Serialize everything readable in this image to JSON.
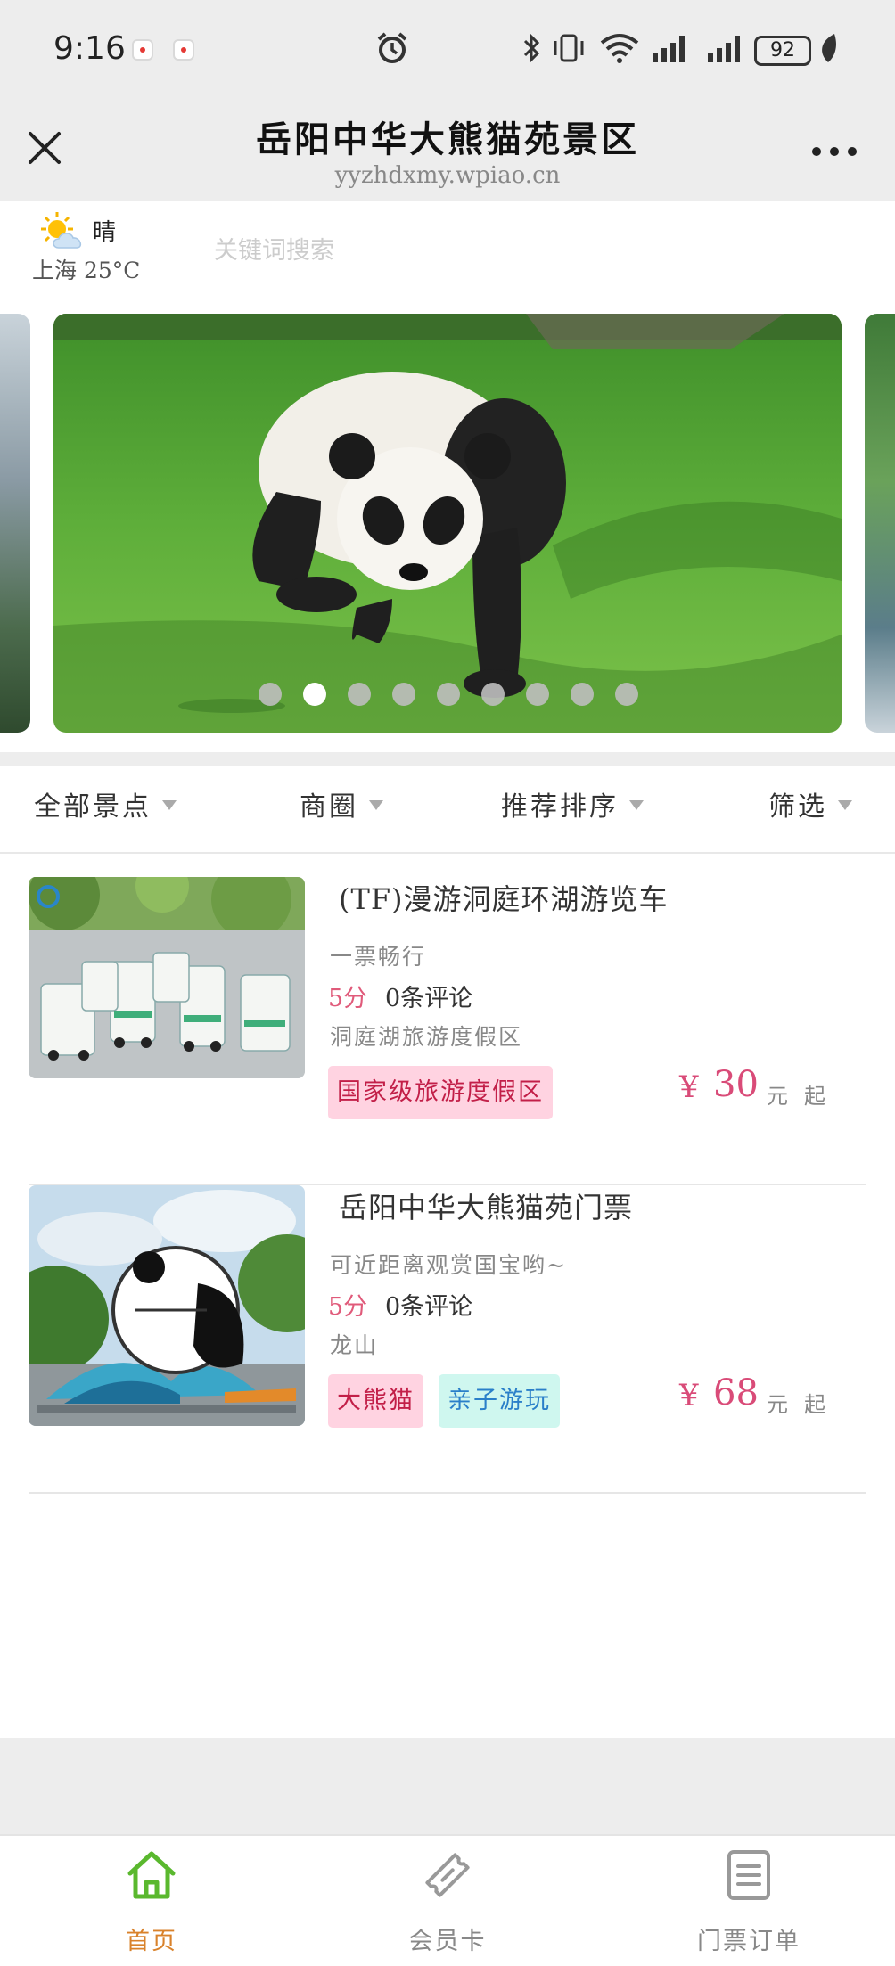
{
  "status_bar": {
    "time": "9:16",
    "battery": "92"
  },
  "header": {
    "title": "岳阳中华大熊猫苑景区",
    "url": "yyzhdxmy.wpiao.cn",
    "close_icon": "close-icon",
    "more_icon": "more-dots-icon"
  },
  "weather": {
    "condition": "晴",
    "city_temp": "上海 25°C",
    "icon": "sun-cloud-icon"
  },
  "search": {
    "placeholder": "关键词搜索",
    "value": ""
  },
  "banner": {
    "slide_count": 9,
    "active_index": 1
  },
  "filters": [
    {
      "label": "全部景点"
    },
    {
      "label": "商圈"
    },
    {
      "label": "推荐排序"
    },
    {
      "label": "筛选"
    }
  ],
  "items": [
    {
      "title": "(TF)漫游洞庭环湖游览车",
      "desc": "一票畅行",
      "score": "5分",
      "reviews": "0条评论",
      "location": "洞庭湖旅游度假区",
      "tags": [
        {
          "label": "国家级旅游度假区",
          "color": "#ffd3e1"
        }
      ],
      "currency": "¥",
      "price": "30",
      "unit": "元",
      "from": "起"
    },
    {
      "title": "岳阳中华大熊猫苑门票",
      "desc": "可近距离观赏国宝哟~",
      "score": "5分",
      "reviews": "0条评论",
      "location": "龙山",
      "tags": [
        {
          "label": "大熊猫",
          "color": "#ffd3e1"
        },
        {
          "label": "亲子游玩",
          "color": "#cff7ef"
        }
      ],
      "currency": "¥",
      "price": "68",
      "unit": "元",
      "from": "起"
    }
  ],
  "bottom_nav": [
    {
      "label": "首页",
      "icon": "home-icon",
      "active": true,
      "color": "#d9822b"
    },
    {
      "label": "会员卡",
      "icon": "ticket-icon",
      "active": false,
      "color": "#888888"
    },
    {
      "label": "门票订单",
      "icon": "order-list-icon",
      "active": false,
      "color": "#888888"
    }
  ],
  "colors": {
    "accent_orange": "#d9822b",
    "home_icon_green": "#5ab82e",
    "price_pink": "#d94b78"
  }
}
